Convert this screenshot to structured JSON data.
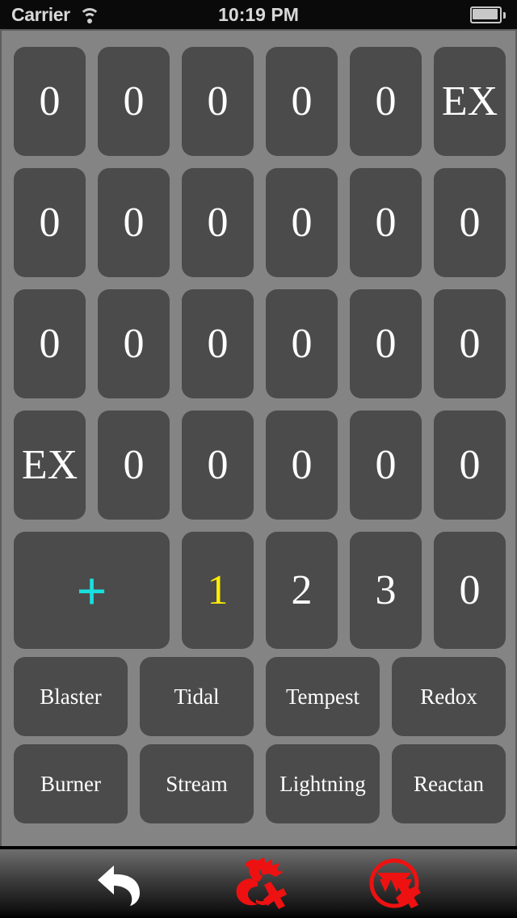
{
  "status_bar": {
    "carrier": "Carrier",
    "wifi_icon": "wifi-icon",
    "time": "10:19 PM",
    "battery_icon": "battery-icon"
  },
  "board": {
    "background_color": "#848484",
    "cell_color": "#4b4b4b",
    "grid_rows": [
      {
        "cells": [
          "0",
          "0",
          "0",
          "0",
          "0",
          "EX"
        ]
      },
      {
        "cells": [
          "0",
          "0",
          "0",
          "0",
          "0",
          "0"
        ]
      },
      {
        "cells": [
          "0",
          "0",
          "0",
          "0",
          "0",
          "0"
        ]
      },
      {
        "cells": [
          "EX",
          "0",
          "0",
          "0",
          "0",
          "0"
        ]
      }
    ],
    "action_row": {
      "plus_label": "+",
      "plus_color": "#18e0e0",
      "cells": [
        {
          "label": "1",
          "color": "#ffee00"
        },
        {
          "label": "2",
          "color": "#ffffff"
        },
        {
          "label": "3",
          "color": "#ffffff"
        },
        {
          "label": "0",
          "color": "#ffffff"
        }
      ]
    },
    "word_rows": [
      {
        "cells": [
          "Blaster",
          "Tidal",
          "Tempest",
          "Redox"
        ]
      },
      {
        "cells": [
          "Burner",
          "Stream",
          "Lightning",
          "Reactan"
        ]
      }
    ]
  },
  "toolbar": {
    "undo_icon": "undo-arrow-icon",
    "dragon_clear_icon": "dragon-cancel-icon",
    "circle_clear_icon": "circle-cancel-icon",
    "accent_red": "#ee1111"
  }
}
